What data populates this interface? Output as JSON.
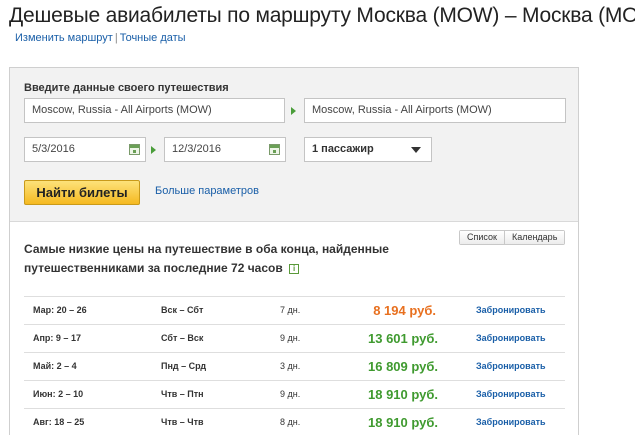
{
  "page": {
    "title": "Дешевые авиабилеты по маршруту Москва (MOW) – Москва (MOW)",
    "links": {
      "change_route": "Изменить маршрут",
      "separator": "|",
      "exact_dates": "Точные даты"
    }
  },
  "search_form": {
    "heading": "Введите данные своего путешествия",
    "origin": "Moscow, Russia - All Airports (MOW)",
    "destination": "Moscow, Russia - All Airports (MOW)",
    "depart_date": "5/3/2016",
    "return_date": "12/3/2016",
    "passengers": "1 пассажир",
    "search_button": "Найти билеты",
    "more_options": "Больше параметров"
  },
  "results": {
    "heading": "Самые низкие цены на путешествие в оба конца, найденные путешественниками за последние 72 часов",
    "info_icon": "i",
    "view_toggle": [
      "Список",
      "Календарь"
    ],
    "rows": [
      {
        "dates": "Мар: 20 – 26",
        "days": "Вск – Сбт",
        "duration": "7 дн.",
        "price": "8 194 руб.",
        "book": "Забронировать",
        "highlight": true
      },
      {
        "dates": "Апр: 9 – 17",
        "days": "Сбт – Вск",
        "duration": "9 дн.",
        "price": "13 601 руб.",
        "book": "Забронировать",
        "highlight": false
      },
      {
        "dates": "Май: 2 – 4",
        "days": "Пнд – Срд",
        "duration": "3 дн.",
        "price": "16 809 руб.",
        "book": "Забронировать",
        "highlight": false
      },
      {
        "dates": "Июн: 2 – 10",
        "days": "Чтв – Птн",
        "duration": "9 дн.",
        "price": "18 910 руб.",
        "book": "Забронировать",
        "highlight": false
      },
      {
        "dates": "Авг: 18 – 25",
        "days": "Чтв – Чтв",
        "duration": "8 дн.",
        "price": "18 910 руб.",
        "book": "Забронировать",
        "highlight": false
      }
    ]
  },
  "colors": {
    "link": "#1a5fa8",
    "price_green": "#3f9a2f",
    "price_orange": "#e8701f",
    "button_yellow": "#f5b921"
  }
}
